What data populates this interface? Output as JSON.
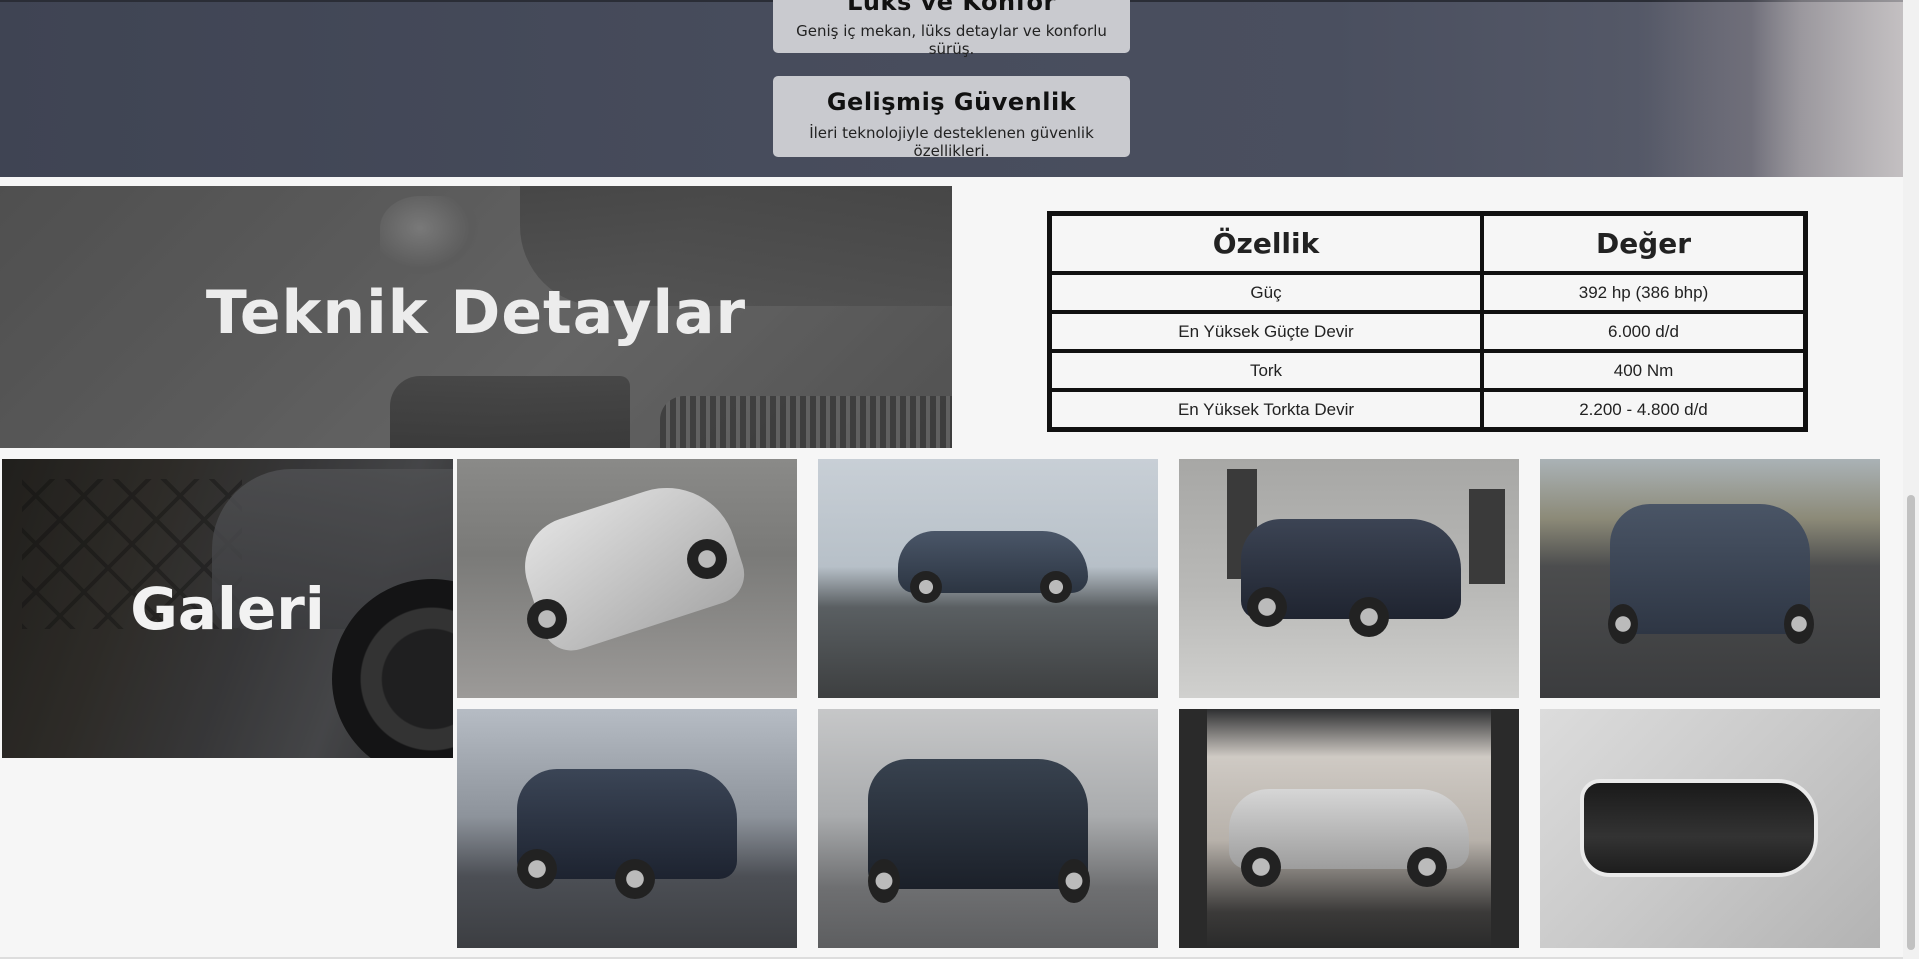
{
  "features": [
    {
      "title": "Lüks ve Konfor",
      "desc": "Geniş iç mekan, lüks detaylar ve konforlu sürüş."
    },
    {
      "title": "Gelişmiş Güvenlik",
      "desc": "İleri teknolojiyle desteklenen güvenlik özellikleri."
    }
  ],
  "tech": {
    "title": "Teknik Detaylar",
    "headers": [
      "Özellik",
      "Değer"
    ],
    "rows": [
      [
        "Güç",
        "392 hp (386 bhp)"
      ],
      [
        "En Yüksek Güçte Devir",
        "6.000 d/d"
      ],
      [
        "Tork",
        "400 Nm"
      ],
      [
        "En Yüksek Torkta Devir",
        "2.200 - 4.800 d/d"
      ]
    ]
  },
  "gallery": {
    "title": "Galeri",
    "photos": [
      {
        "name": "gallery-photo-silver-suv-top-view",
        "car_color": "#c9c9c9"
      },
      {
        "name": "gallery-photo-blue-suv-rocky-coast",
        "car_color": "#3a4656"
      },
      {
        "name": "gallery-photo-dark-suv-rear-building",
        "car_color": "#2d3442"
      },
      {
        "name": "gallery-photo-dark-suv-road-front",
        "car_color": "#3b4452"
      },
      {
        "name": "gallery-photo-dark-suv-street-front",
        "car_color": "#2a3240"
      },
      {
        "name": "gallery-photo-dark-suv-building-front",
        "car_color": "#27303b"
      },
      {
        "name": "gallery-photo-silver-suv-bridge-side",
        "car_color": "#b9babb"
      },
      {
        "name": "gallery-photo-headlight-closeup",
        "car_color": "#d6d6d6"
      }
    ]
  }
}
